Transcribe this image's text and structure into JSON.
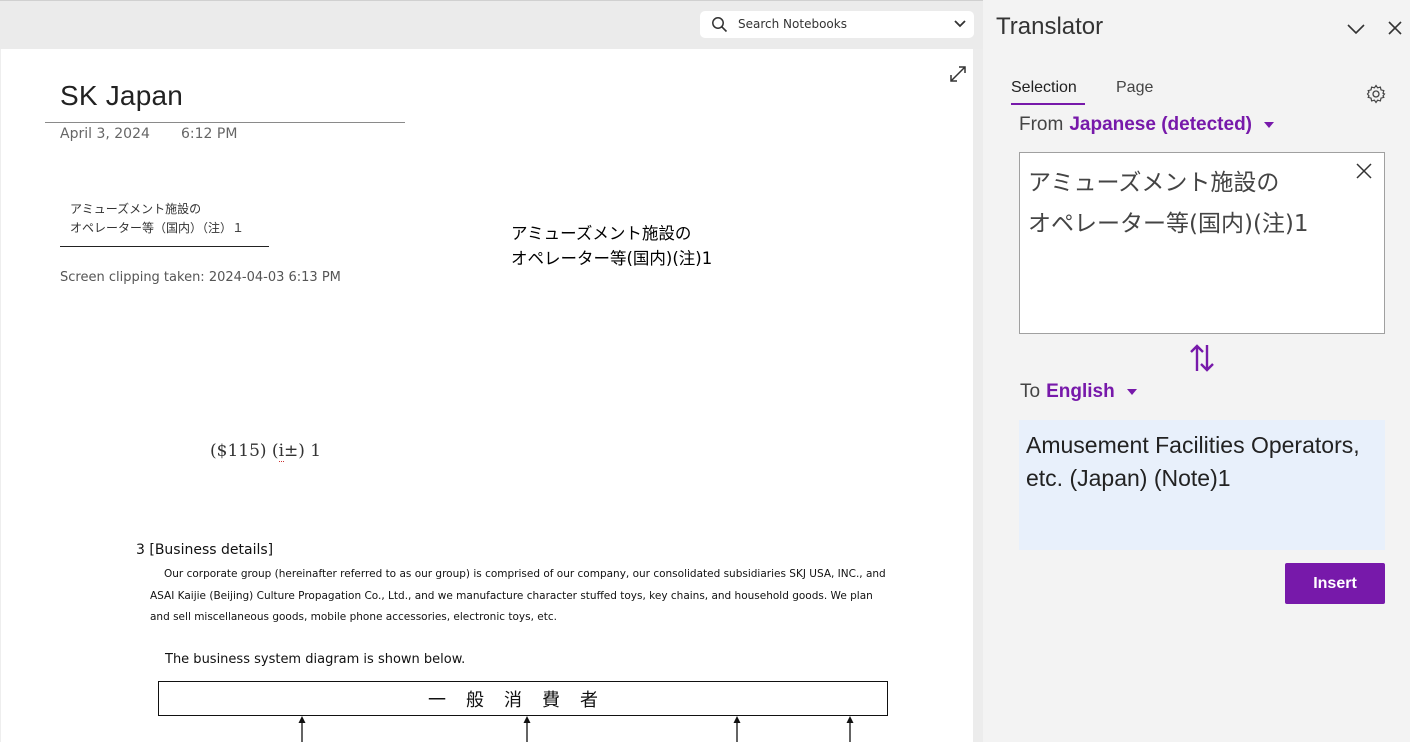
{
  "search": {
    "placeholder": "Search Notebooks"
  },
  "note": {
    "title": "SK Japan",
    "date": "April 3, 2024",
    "time": "6:12 PM",
    "clip_line1": "アミューズメント施設の",
    "clip_line2": "オペレーター等（国内）（注）１",
    "clip_caption": "Screen clipping taken: 2024-04-03 6:13 PM",
    "jp_line1": "アミューズメント施設の",
    "jp_line2": "オペレーター等(国内)(注)1",
    "money_a": "($115) (",
    "money_b": "i",
    "money_c": "±) 1",
    "business_title": "3 [Business details]",
    "business_para": "Our corporate group (hereinafter referred to as our group) is comprised of our company, our consolidated subsidiaries SKJ USA, INC., and ASAI Kaijie (Beijing) Culture Propagation Co., Ltd., and we manufacture character stuffed toys, key chains, and household goods. We plan and sell miscellaneous goods, mobile phone accessories, electronic toys, etc.",
    "diagram_caption": "The business system diagram is shown below.",
    "diagram_box": "一般消費者"
  },
  "translator": {
    "title": "Translator",
    "tabs": [
      "Selection",
      "Page"
    ],
    "from_label": "From",
    "from_lang": "Japanese (detected)",
    "source_text_1": "アミューズメント施設の",
    "source_text_2": "オペレーター等(国内)(注)1",
    "to_label": "To",
    "to_lang": "English",
    "output_text": "Amusement Facilities Operators, etc. (Japan) (Note)1",
    "insert_label": "Insert"
  },
  "colors": {
    "accent": "#7719aa",
    "output_bg": "#e8f0fb"
  },
  "icons": [
    "search-icon",
    "chevron-down-icon",
    "expand-icon",
    "collapse-icon",
    "close-icon",
    "gear-icon",
    "clear-icon",
    "swap-icon"
  ]
}
